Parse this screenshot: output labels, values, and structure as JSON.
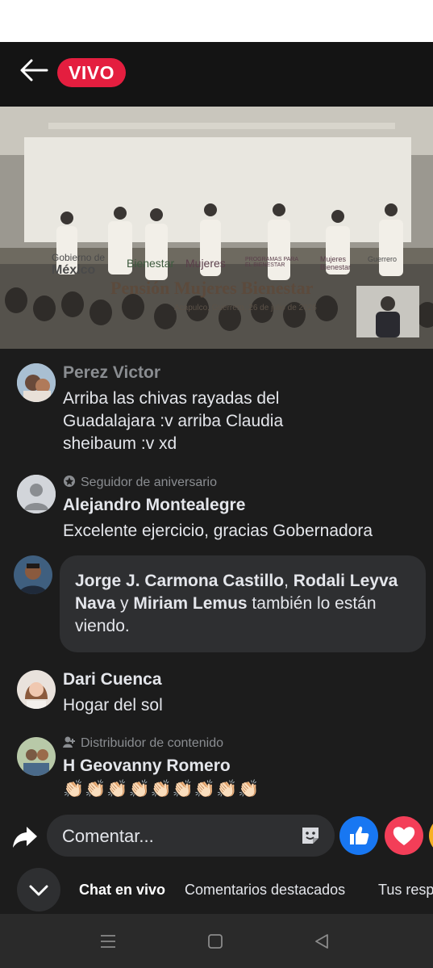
{
  "header": {
    "live_badge": "VIVO"
  },
  "video": {
    "logos": [
      "Gobierno de",
      "México",
      "Bienestar",
      "Mujeres",
      "PROGRAMAS PARA EL BIENESTAR",
      "Mujeres Bienestar",
      "Guerrero"
    ],
    "title": "Pensión Mujeres Bienestar",
    "subtitle": "Acapulco, Guerrero, 26 de julio de 2026"
  },
  "comments": [
    {
      "name": "Perez Victor",
      "text": "Arriba las chivas rayadas del Guadalajara :v arriba Claudia sheibaum :v xd"
    },
    {
      "badge": "Seguidor de aniversario",
      "name": "Alejandro Montealegre",
      "text": "Excelente ejercicio, gracias Gobernadora"
    },
    {
      "name": "Dari Cuenca",
      "text": "Hogar del sol"
    },
    {
      "badge": "Distribuidor de contenido",
      "name": "H Geovanny Romero",
      "text": "👏🏻👏🏻👏🏻👏🏻👏🏻👏🏻👏🏻👏🏻👏🏻"
    }
  ],
  "join_notice": {
    "name1": "Jorge J. Carmona Castillo",
    "sep1": ", ",
    "name2": "Rodali Leyva Nava",
    "sep2": " y ",
    "name3": "Miriam Lemus",
    "suffix": " también lo están viendo."
  },
  "composer": {
    "placeholder": "Comentar..."
  },
  "tabs": [
    {
      "label": "Chat en vivo"
    },
    {
      "label": "Comentarios destacados"
    },
    {
      "label": "Tus resp"
    }
  ],
  "colors": {
    "live_red": "#e41e3f",
    "like_blue": "#1877f2",
    "love_red": "#f33e58"
  }
}
